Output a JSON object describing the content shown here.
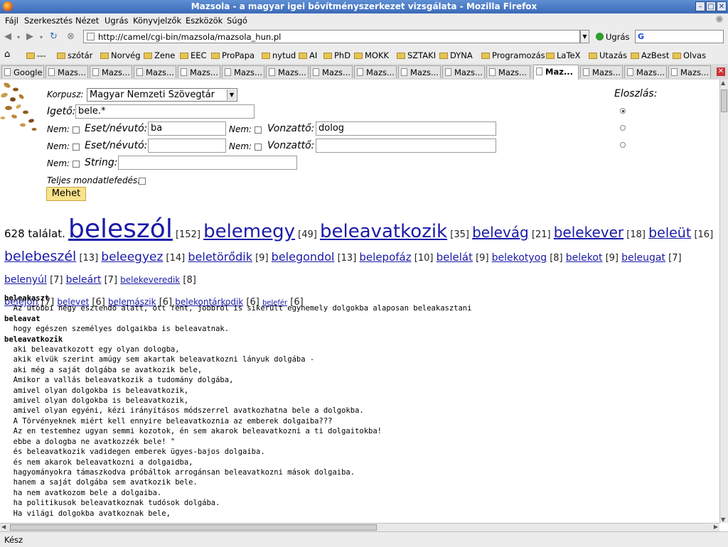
{
  "window": {
    "title": "Mazsola - a magyar igei bővítményszerkezet vizsgálata - Mozilla Firefox"
  },
  "menu": [
    "Fájl",
    "Szerkesztés",
    "Nézet",
    "Ugrás",
    "Könyvjelzők",
    "Eszközök",
    "Súgó"
  ],
  "nav": {
    "url": "http://camel/cgi-bin/mazsola/mazsola_hun.pl",
    "go_label": "Ugrás",
    "search_value": ""
  },
  "bookmarks": [
    "---",
    "szótár",
    "Norvég",
    "Zene",
    "EEC",
    "ProPapa",
    "nytud",
    "AI",
    "PhD",
    "MOKK",
    "SZTAKI",
    "DYNA",
    "Programozás",
    "LaTeX",
    "Utazás",
    "AzBest",
    "Olvas"
  ],
  "tabs": [
    "Google",
    "Mazs...",
    "Mazs...",
    "Mazs...",
    "Mazs...",
    "Mazs...",
    "Mazs...",
    "Mazs...",
    "Mazs...",
    "Mazs...",
    "Mazs...",
    "Mazs...",
    "Maz...",
    "Mazs...",
    "Mazs...",
    "Mazs..."
  ],
  "form": {
    "korpusz_label": "Korpusz:",
    "korpusz_value": "Magyar Nemzeti Szövegtár",
    "igeto_label": "Igető:",
    "igeto_value": "bele.*",
    "nem": "Nem:",
    "eset_label": "Eset/névutó:",
    "vonzatto_label": "Vonzattő:",
    "eset1": "ba",
    "vonzatto1": "dolog",
    "eset2": "",
    "vonzatto2": "",
    "string_label": "String:",
    "string_value": "",
    "teljes_label": "Teljes mondatlefedés:",
    "submit": "Mehet",
    "eloszlas_label": "Eloszlás:"
  },
  "summary": {
    "count_text": "628 találat."
  },
  "cloud": [
    {
      "word": "beleszól",
      "count": "[152]"
    },
    {
      "word": "belemegy",
      "count": "[49]"
    },
    {
      "word": "beleavatkozik",
      "count": "[35]"
    },
    {
      "word": "belevág",
      "count": "[21]"
    },
    {
      "word": "belekever",
      "count": "[18]"
    },
    {
      "word": "beleüt",
      "count": "[16]"
    },
    {
      "word": "belebeszél",
      "count": "[13]"
    },
    {
      "word": "beleegyez",
      "count": "[14]"
    },
    {
      "word": "beletörődik",
      "count": "[9]"
    },
    {
      "word": "belegondol",
      "count": "[13]"
    },
    {
      "word": "belepofáz",
      "count": "[10]"
    },
    {
      "word": "belelát",
      "count": "[9]"
    },
    {
      "word": "belekotyog",
      "count": "[8]"
    },
    {
      "word": "belekot",
      "count": "[9]"
    },
    {
      "word": "beleugat",
      "count": "[7]"
    },
    {
      "word": "belenyúl",
      "count": "[7]"
    },
    {
      "word": "beleárt",
      "count": "[7]"
    },
    {
      "word": "belekeveredik",
      "count": "[8]"
    },
    {
      "word": "belejön",
      "count": "[7]"
    },
    {
      "word": "belevet",
      "count": "[6]"
    },
    {
      "word": "belemászik",
      "count": "[6]"
    },
    {
      "word": "belekontárkodik",
      "count": "[6]"
    },
    {
      "word": "belefér",
      "count": "[6]"
    }
  ],
  "results": [
    {
      "verb": "beleakaszt",
      "lines": [
        "Az utóbbi négy esztendő alatt, ott fent, jobbról is sikerült egynemely dolgokba alaposan beleakasztani"
      ]
    },
    {
      "verb": "beleavat",
      "lines": [
        "hogy egészen személyes dolgaikba is beleavatnak."
      ]
    },
    {
      "verb": "beleavatkozik",
      "lines": [
        "aki beleavatkozott egy olyan dologba,",
        "akik elvük szerint amúgy sem akartak beleavatkozni lányuk dolgába -",
        "aki még a saját dolgába se avatkozik bele,",
        "Amikor a vallás beleavatkozik a tudomány dolgába,",
        "amivel olyan dolgokba is beleavatkozik,",
        "amivel olyan dolgokba is beleavatkozik,",
        "amivel olyan egyéni, kézi irányításos módszerrel avatkozhatna bele a dolgokba.",
        "A Törvényeknek miért kell ennyire beleavatkoznia az emberek dolgaiba???",
        "Az en testemhez ugyan semmi kozotok, én sem akarok beleavatkozni a ti dolgaitokba!",
        "ebbe a dologba ne avatkozzék bele! \"",
        "és beleavatkozik vadidegen emberek ügyes-bajos dolgaiba.",
        "és nem akarok beleavatkozni a dolgaidba,",
        "hagyományokra támaszkodva próbáltok arrogánsan beleavatkozni mások dolgaiba.",
        "hanem a saját dolgába sem avatkozik bele.",
        "ha nem avatkozom bele a dolgaiba.",
        "ha politikusok beleavatkoznak tudósok dolgába.",
        "Ha világi dolgokba avatkoznak bele,"
      ]
    }
  ],
  "status": {
    "text": "Kész"
  },
  "colors": {
    "link": "#1a1aa8",
    "button_bg": "#fbe38b",
    "title_bar": "#3b6ab8"
  }
}
